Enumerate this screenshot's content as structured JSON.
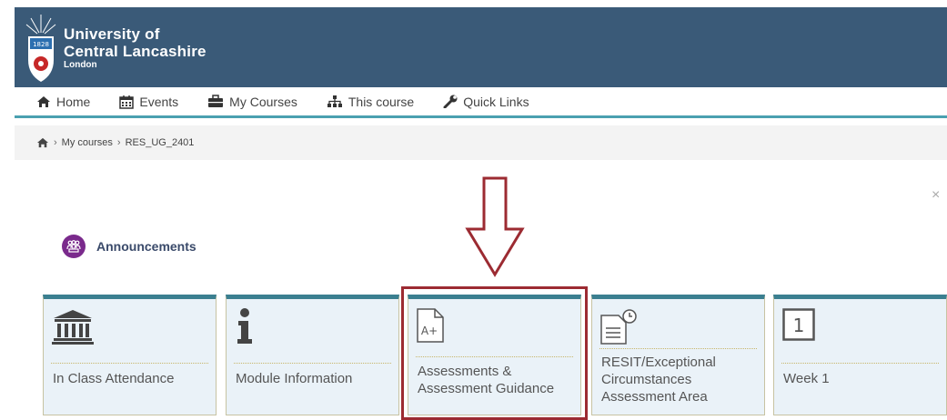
{
  "branding": {
    "line1": "University of",
    "line2": "Central Lancashire",
    "line3": "London",
    "crest_year": "1828"
  },
  "nav": {
    "items": [
      {
        "label": "Home",
        "icon": "home-icon"
      },
      {
        "label": "Events",
        "icon": "calendar-icon"
      },
      {
        "label": "My Courses",
        "icon": "briefcase-icon"
      },
      {
        "label": "This course",
        "icon": "sitemap-icon"
      },
      {
        "label": "Quick Links",
        "icon": "wrench-icon"
      }
    ]
  },
  "breadcrumb": {
    "items": [
      "My courses",
      "RES_UG_2401"
    ],
    "separator": "›"
  },
  "close_label": "×",
  "announcements": {
    "label": "Announcements"
  },
  "tiles": [
    {
      "label": "In Class Attendance",
      "icon": "building-icon"
    },
    {
      "label": "Module Information",
      "icon": "info-icon"
    },
    {
      "label": "Assessments & Assessment Guidance",
      "icon": "grade-document-icon",
      "icon_text": "A+"
    },
    {
      "label": "RESIT/Exceptional Circumstances Assessment Area",
      "icon": "document-clock-icon"
    },
    {
      "label": "Week 1",
      "icon": "number-box-icon",
      "icon_text": "1"
    }
  ],
  "colors": {
    "header_bg": "#3a5a78",
    "nav_border": "#4aa0b0",
    "tile_top": "#3b7f90",
    "tile_bg": "#eaf2f8",
    "highlight": "#9c2b32",
    "announce_icon": "#7a2a8c"
  }
}
